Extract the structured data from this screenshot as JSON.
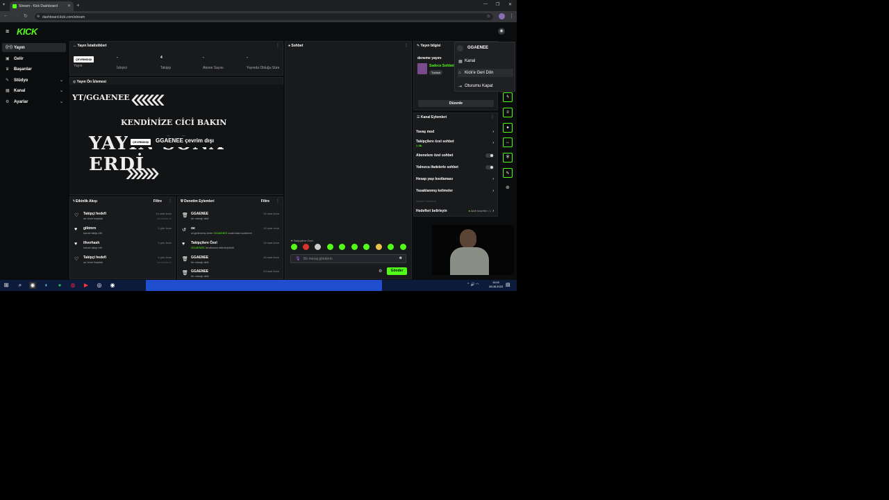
{
  "browser": {
    "tab_title": "Stream - Kick Dashboard",
    "url": "dashboard.kick.com/stream"
  },
  "app": {
    "logo": "KICK"
  },
  "sidebar": {
    "items": [
      {
        "label": "Yayın",
        "icon": "broadcast-icon",
        "active": true
      },
      {
        "label": "Gelir",
        "icon": "money-icon"
      },
      {
        "label": "Başarılar",
        "icon": "trophy-icon"
      },
      {
        "label": "Stüdyo",
        "icon": "studio-icon",
        "expandable": true
      },
      {
        "label": "Kanal",
        "icon": "channel-icon",
        "expandable": true
      },
      {
        "label": "Ayarlar",
        "icon": "gear-icon",
        "expandable": true
      }
    ]
  },
  "stats": {
    "title": "Yayın İstatistikleri",
    "status_badge": "ÇEVRİMDIŞI",
    "items": [
      {
        "value": "",
        "label": "Yayın"
      },
      {
        "value": "-",
        "label": "İzleyici"
      },
      {
        "value": "4",
        "label": "Takipçi"
      },
      {
        "value": "-",
        "label": "Abone Sayısı"
      },
      {
        "value": "-",
        "label": "Yayında Olduğu Süre"
      }
    ]
  },
  "preview": {
    "title": "Yayın Ön İzlemesi",
    "handle": "YT/GGAENEE",
    "line1": "KENDİNİZE CİCİ BAKIN",
    "line2": "YAYIN SONA ERDİ",
    "offline_badge": "ÇEVRİMDIŞI",
    "offline_text": "GGAENEE çevrim dışı"
  },
  "activity": {
    "title": "Etkinlik Akışı",
    "filter": "Filtre",
    "rows": [
      {
        "title": "Takipçi hedefi",
        "sub": "az önce başladı",
        "time": "14 saat önce",
        "status": "tamamlandı"
      },
      {
        "title": "giktmrn",
        "sub": "kanalı takip etti",
        "time": "1 gün önce",
        "status": ""
      },
      {
        "title": "illverhash",
        "sub": "kanalı takip etti",
        "time": "1 gün önce",
        "status": ""
      },
      {
        "title": "Takipçi hedefi",
        "sub": "az önce başladı",
        "time": "1 gün önce",
        "status": "tamamlandı"
      }
    ]
  },
  "moderation": {
    "title": "Denetim Eylemleri",
    "filter": "Filtre",
    "rows": [
      {
        "title": "GGAENEE",
        "sub": "bir mesajı sildi",
        "time": "14 saat önce"
      },
      {
        "title": "oe",
        "sub_pre": "engellenmiş terim",
        "sub_user": "GGAENEE",
        "sub_post": "tarafından kaldırıldı",
        "time": "14 saat önce"
      },
      {
        "title": "Takipçilere Özel",
        "sub_user": "GGAENEE",
        "sub_post": "tarafından etkinleştirildi",
        "time": "14 saat önce"
      },
      {
        "title": "GGAENEE",
        "sub": "bir mesajı sildi",
        "time": "15 saat önce"
      },
      {
        "title": "GGAENEE",
        "sub": "bir mesajı sildi",
        "time": "23 saat önce"
      }
    ]
  },
  "chat": {
    "title": "Sohbet",
    "followers_only": "Takipçilere Özel",
    "placeholder": "Bir mesaj gönderin",
    "send": "Gönder"
  },
  "stream_info": {
    "title": "Yayın bilgisi",
    "stream_title": "deneme yayını",
    "category": "Sadece Sohbet",
    "language": "Turkish",
    "edit_button": "Düzenle"
  },
  "channel_actions": {
    "title": "Kanal Eylemleri",
    "slow_mode": "Yavaş mod",
    "followers_chat": "Takipçilere özel sohbet",
    "followers_chat_value": "1 dk.",
    "subs_chat": "Abonelere özel sohbet",
    "emotes_chat": "Yalnızca ifadelerle sohbet",
    "account_age": "Hesap yaşı kısıtlaması",
    "banned_words": "Yasaklanmış kelimeler",
    "viewers_label": "İzleyici Yönetimi",
    "goals": "Hedefleri belirleyin",
    "goals_value": "Aktif hedefler • 1"
  },
  "user_menu": {
    "username": "GGAENEE",
    "items": [
      {
        "label": "Kanal",
        "icon": "channel-icon"
      },
      {
        "label": "Kick'e Geri Dön",
        "icon": "home-icon"
      },
      {
        "label": "Oturumu Kapat",
        "icon": "logout-icon"
      }
    ]
  },
  "taskbar": {
    "time": "15:02",
    "date": "28.08.2023"
  },
  "colors": {
    "accent": "#53fc18",
    "panel": "#191a1c",
    "background": "#0b0c0d"
  }
}
